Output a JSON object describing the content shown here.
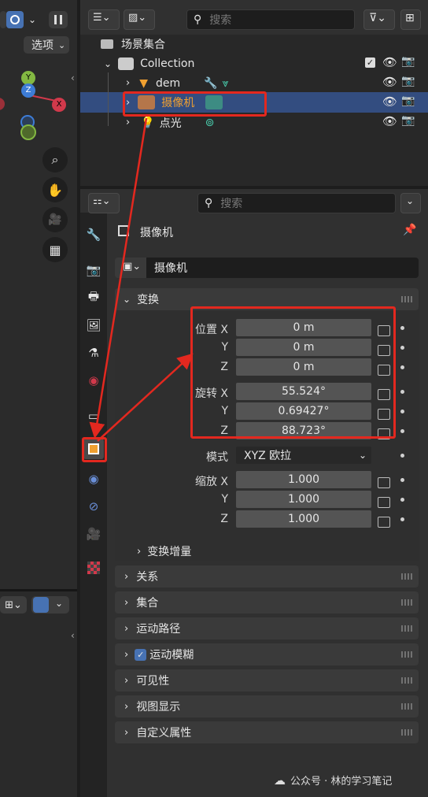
{
  "viewport": {
    "options_label": "选项"
  },
  "outliner": {
    "search_placeholder": "搜索",
    "scene_label": "场景集合",
    "collection_label": "Collection",
    "items": [
      {
        "label": "dem"
      },
      {
        "label": "摄像机"
      },
      {
        "label": "点光"
      }
    ]
  },
  "properties": {
    "search_placeholder": "搜索",
    "object_title": "摄像机",
    "object_name_field": "摄像机",
    "transform": {
      "title": "变换",
      "location_label": "位置 X",
      "rotation_label": "旋转 X",
      "scale_label": "缩放 X",
      "y_label": "Y",
      "z_label": "Z",
      "location": [
        "0 m",
        "0 m",
        "0 m"
      ],
      "rotation": [
        "55.524°",
        "0.69427°",
        "88.723°"
      ],
      "mode_label": "模式",
      "mode_value": "XYZ 欧拉",
      "scale": [
        "1.000",
        "1.000",
        "1.000"
      ],
      "delta_label": "变换增量"
    },
    "panels": [
      "关系",
      "集合",
      "运动路径",
      "运动模糊",
      "可见性",
      "视图显示",
      "自定义属性"
    ]
  },
  "watermark": "公众号 · 林的学习笔记",
  "colors": {
    "accent_selected": "#334d80",
    "highlight_red": "#e3281f",
    "camera_orange": "#f0a030",
    "camera_teal": "#4ad0b0"
  }
}
